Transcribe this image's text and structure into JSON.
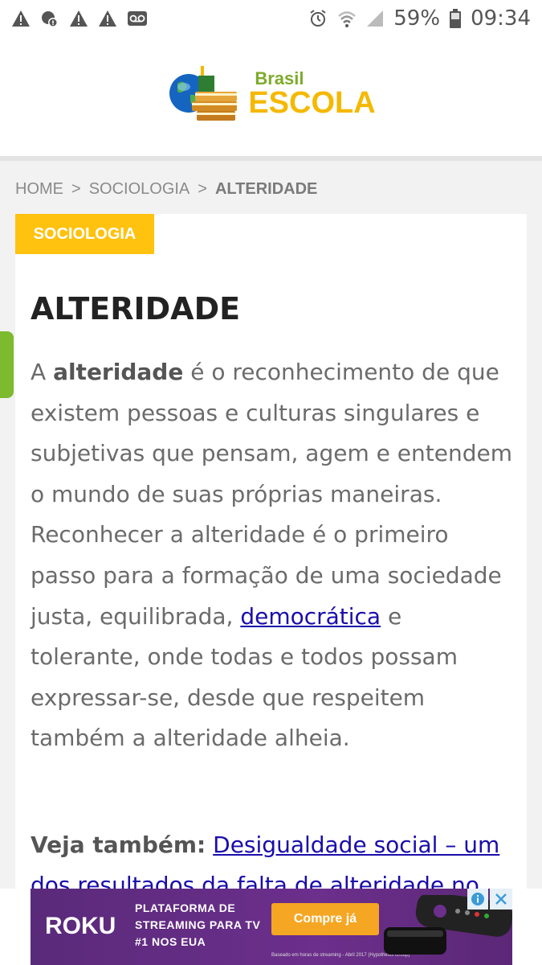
{
  "status_bar": {
    "left_icons": [
      "warning-icon",
      "blocked-sync-icon",
      "warning-icon",
      "warning-icon",
      "voicemail-icon"
    ],
    "right_icons": [
      "alarm-icon",
      "wifi-icon",
      "signal-icon",
      "battery-icon"
    ],
    "battery": "59%",
    "time": "09:34"
  },
  "header": {
    "logo_brasil": "Brasil",
    "logo_escola": "ESCOLA"
  },
  "breadcrumb": {
    "home": "HOME",
    "sep1": ">",
    "section": "SOCIOLOGIA",
    "sep2": ">",
    "current": "ALTERIDADE"
  },
  "article": {
    "category": "SOCIOLOGIA",
    "title": "ALTERIDADE",
    "para_a": "A ",
    "para_term": "alteridade",
    "para_b": " é o reconhecimento de que existem pessoas e culturas singulares e subjetivas que pensam, agem e entendem o mundo de suas próprias maneiras. Reconhecer a alteridade é o primeiro passo para a formação de uma sociedade justa, equilibrada, ",
    "para_link": "democrática",
    "para_c": " e tolerante, onde todas e todos possam expressar-se, desde que respeitem também a alteridade alheia.",
    "see_also_label": "Veja também:",
    "see_also_link": "Desigualdade social – um dos resultados da falta de alteridade no"
  },
  "ad": {
    "brand": "ROKU",
    "headline": "PLATAFORMA DE STREAMING PARA TV #1 NOS EUA",
    "cta": "Compre já",
    "fineprint": "Baseado em horas de streaming - Abril 2017 (Hypothesis Group)",
    "colors": {
      "background": "#6c2f8c",
      "cta": "#f5a623"
    }
  },
  "colors": {
    "category_badge": "#ffc20e",
    "link": "#1a0dab",
    "side_tab": "#7dba2e"
  }
}
